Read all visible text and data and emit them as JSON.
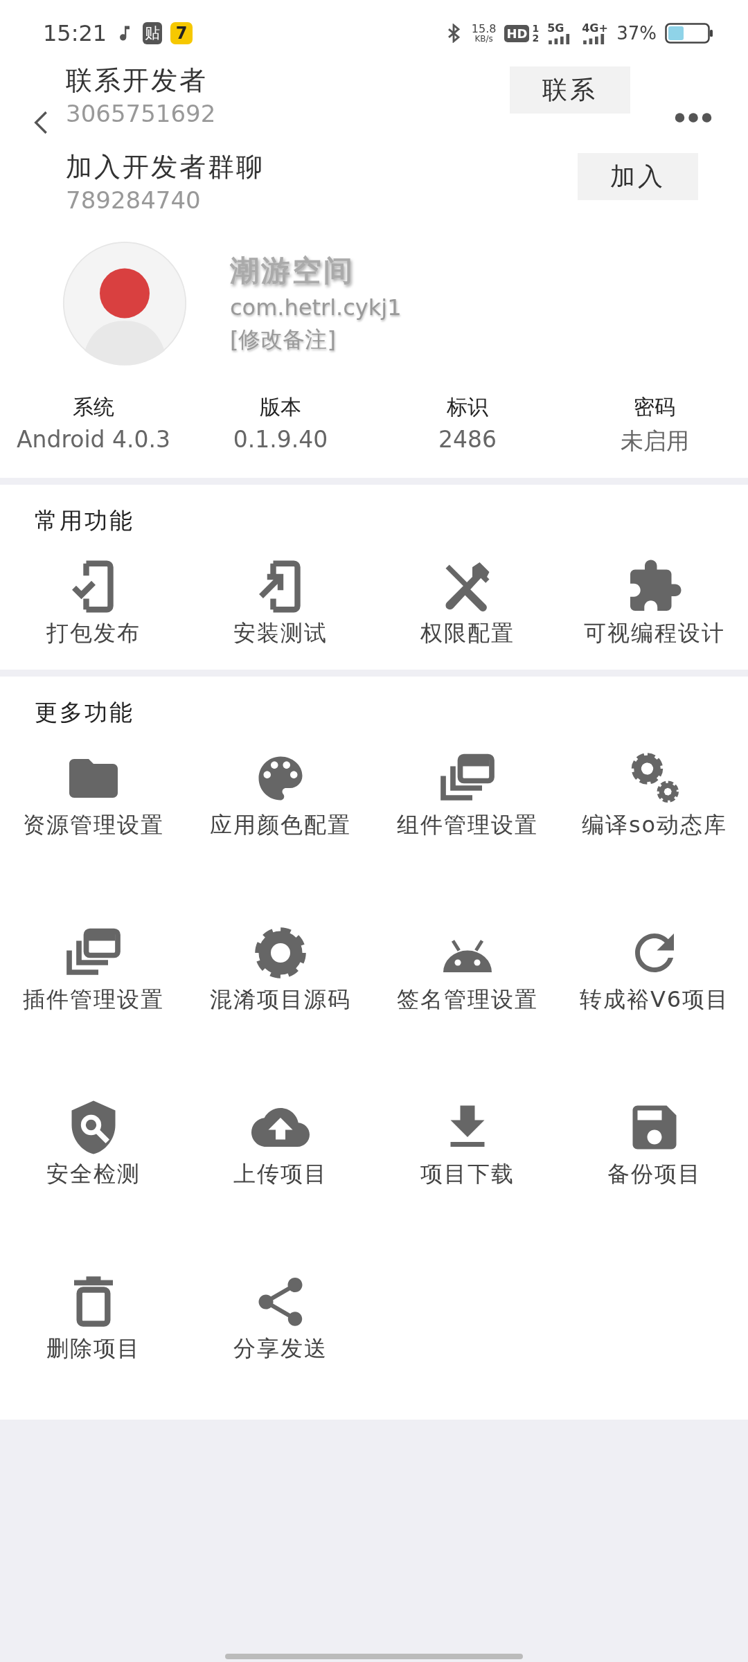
{
  "status_bar": {
    "time": "15:21",
    "notifications": [
      {
        "kind": "badge",
        "text": "贴"
      },
      {
        "kind": "app",
        "text": "7"
      }
    ],
    "speed": "15.8",
    "speed_unit": "KB/s",
    "hd": "HD",
    "sim_slots": [
      "1",
      "2"
    ],
    "network_1": "5G",
    "network_2": "4G+",
    "battery": "37%"
  },
  "contacts": [
    {
      "title": "联系开发者",
      "number": "3065751692",
      "button": "联系"
    },
    {
      "title": "加入开发者群聊",
      "number": "789284740",
      "button": "加入"
    }
  ],
  "project": {
    "name": "潮游空间",
    "package": "com.hetrl.cykj1",
    "note": "[修改备注]"
  },
  "stats": [
    {
      "label": "系统",
      "value": "Android 4.0.3"
    },
    {
      "label": "版本",
      "value": "0.1.9.40"
    },
    {
      "label": "标识",
      "value": "2486"
    },
    {
      "label": "密码",
      "value": "未启用"
    }
  ],
  "sections": [
    {
      "title": "常用功能",
      "items": [
        {
          "label": "打包发布",
          "kind": "phone-check"
        },
        {
          "label": "安装测试",
          "kind": "phone-arrow"
        },
        {
          "label": "权限配置",
          "kind": "tools"
        },
        {
          "label": "可视编程设计",
          "kind": "puzzle"
        }
      ]
    },
    {
      "title": "更多功能",
      "items": [
        {
          "label": "资源管理设置",
          "kind": "folder"
        },
        {
          "label": "应用颜色配置",
          "kind": "palette"
        },
        {
          "label": "组件管理设置",
          "kind": "windows"
        },
        {
          "label": "编译so动态库",
          "kind": "gears"
        },
        {
          "label": "插件管理设置",
          "kind": "windows"
        },
        {
          "label": "混淆项目源码",
          "kind": "gear"
        },
        {
          "label": "签名管理设置",
          "kind": "android"
        },
        {
          "label": "转成裕V6项目",
          "kind": "refresh"
        },
        {
          "label": "安全检测",
          "kind": "shield-search"
        },
        {
          "label": "上传项目",
          "kind": "cloud-upload"
        },
        {
          "label": "项目下载",
          "kind": "download"
        },
        {
          "label": "备份项目",
          "kind": "save"
        },
        {
          "label": "删除项目",
          "kind": "trash"
        },
        {
          "label": "分享发送",
          "kind": "share"
        }
      ]
    }
  ]
}
